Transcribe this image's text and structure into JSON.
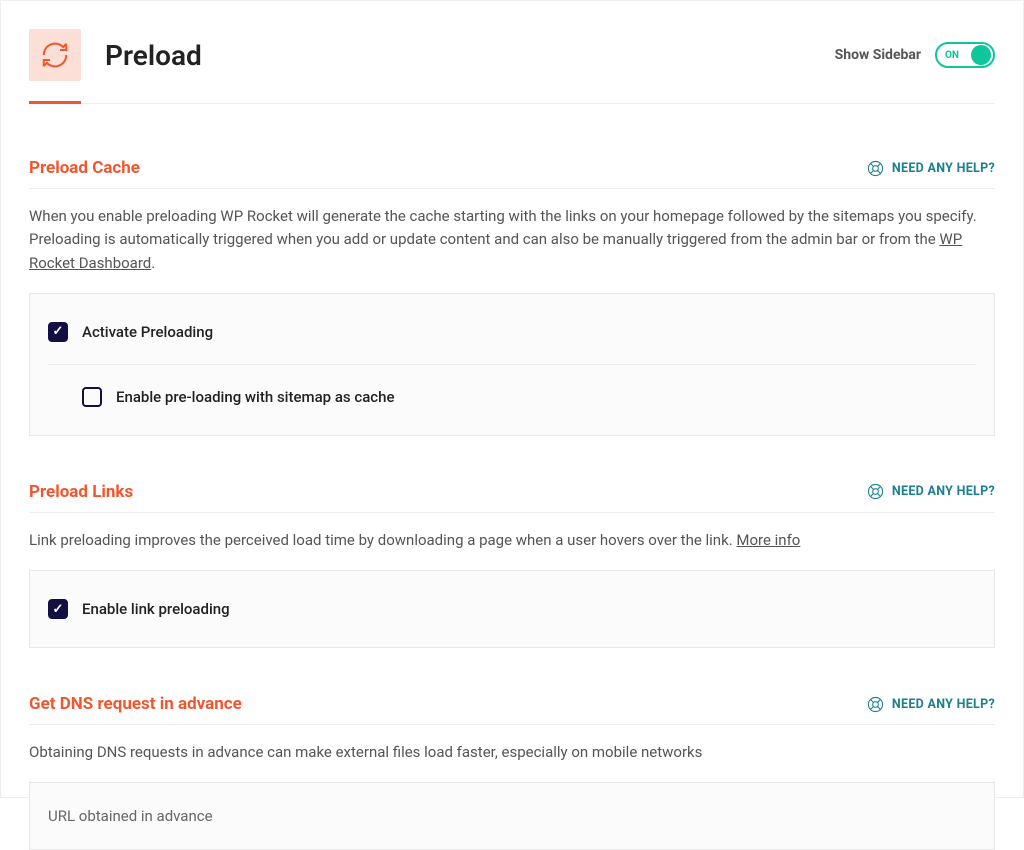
{
  "header": {
    "title": "Preload",
    "show_sidebar_label": "Show Sidebar",
    "toggle_state": "ON"
  },
  "help": {
    "label": "NEED ANY HELP?"
  },
  "sections": {
    "preload_cache": {
      "title": "Preload Cache",
      "desc_part1": "When you enable preloading WP Rocket will generate the cache starting with the links on your homepage followed by the sitemaps you specify. Preloading is automatically triggered when you add or update content and can also be manually triggered from the admin bar or from the ",
      "desc_link": "WP Rocket Dashboard",
      "desc_part2": ".",
      "opt_activate": "Activate Preloading",
      "opt_sitemap": "Enable pre-loading with sitemap as cache"
    },
    "preload_links": {
      "title": "Preload Links",
      "desc_part1": "Link preloading improves the perceived load time by downloading a page when a user hovers over the link. ",
      "desc_link": "More info",
      "opt_enable": "Enable link preloading"
    },
    "dns": {
      "title": "Get DNS request in advance",
      "desc": "Obtaining DNS requests in advance can make external files load faster, especially on mobile networks",
      "box_label": "URL obtained in advance"
    }
  }
}
